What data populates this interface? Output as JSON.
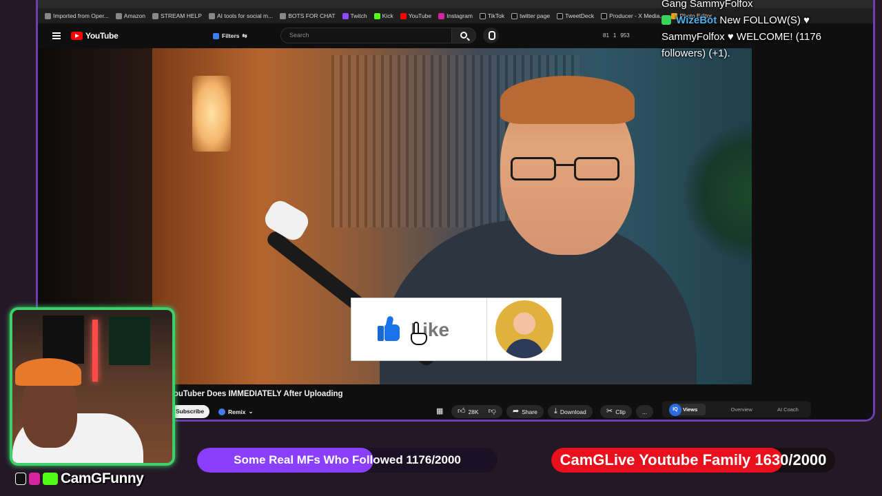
{
  "browser": {
    "bookmarks": [
      {
        "label": "Imported from Oper..."
      },
      {
        "label": "Amazon"
      },
      {
        "label": "STREAM HELP"
      },
      {
        "label": "AI tools for social m..."
      },
      {
        "label": "BOTS FOR CHAT"
      },
      {
        "label": "Twitch"
      },
      {
        "label": "Kick"
      },
      {
        "label": "YouTube"
      },
      {
        "label": "Instagram"
      },
      {
        "label": "TikTok"
      },
      {
        "label": "twitter page"
      },
      {
        "label": "TweetDeck"
      },
      {
        "label": "Producer - X Media..."
      },
      {
        "label": "Photo Editor"
      }
    ]
  },
  "youtube": {
    "logo_text": "YouTube",
    "filters_label": "Filters",
    "search_placeholder": "Search",
    "stats": {
      "a": "81",
      "b": "1",
      "c": "953"
    },
    "like_graphic_text": "Like",
    "video_title": "YouTuber Does IMMEDIATELY After Uploading",
    "subscribe_label": "Subscribe",
    "remix_label": "Remix",
    "like_count": "28K",
    "share_label": "Share",
    "download_label": "Download",
    "clip_label": "Clip",
    "more_label": "...",
    "vidiq_tabs": [
      "Views",
      "Overview",
      "AI Coach"
    ],
    "vidiq_badge": "IQ"
  },
  "chat": {
    "line1": "Gang SammyFolfox",
    "bot_name": "WizeBot",
    "line2_tail": "New FOLLOW(S)",
    "line3": "SammyFolfox ♥ WELCOME! (1176",
    "line4": "followers) (+1)."
  },
  "streamer": {
    "handle": "CamGFunny"
  },
  "goals": [
    {
      "label": "Some Real MFs Who Followed 1176/2000",
      "current": 1176,
      "target": 2000
    },
    {
      "label": "CamGLive Youtube Family 1630/2000",
      "current": 1630,
      "target": 2000
    }
  ],
  "colors": {
    "frame_accent": "#6e3fae",
    "goal1_fill": "#8a3fff",
    "goal2_fill": "#e8101c",
    "webcam_border": "#3ccf6a",
    "youtube_red": "#ff0000"
  }
}
